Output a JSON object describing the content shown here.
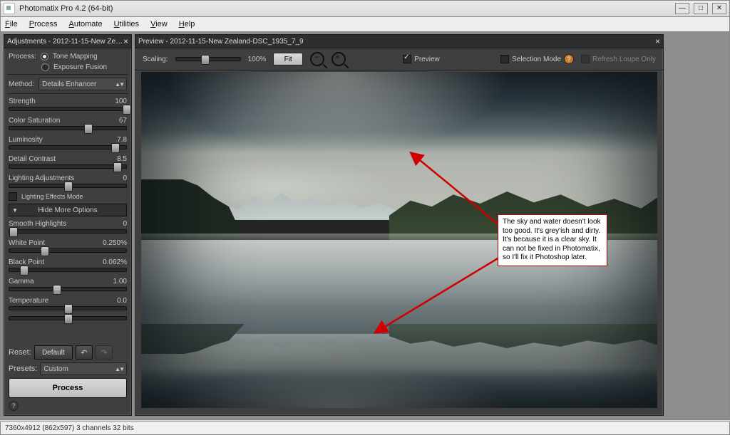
{
  "window": {
    "title": "Photomatix Pro 4.2 (64-bit)"
  },
  "menu": [
    "File",
    "Process",
    "Automate",
    "Utilities",
    "View",
    "Help"
  ],
  "adjust": {
    "title": "Adjustments - 2012-11-15-New Ze…",
    "process_label": "Process:",
    "modes": {
      "tone": "Tone Mapping",
      "fusion": "Exposure Fusion",
      "selected": "tone"
    },
    "method_label": "Method:",
    "method_value": "Details Enhancer",
    "sliders": [
      {
        "label": "Strength",
        "value": "100",
        "pos": 100
      },
      {
        "label": "Color Saturation",
        "value": "67",
        "pos": 67
      },
      {
        "label": "Luminosity",
        "value": "7.8",
        "pos": 90
      },
      {
        "label": "Detail Contrast",
        "value": "8.5",
        "pos": 92
      },
      {
        "label": "Lighting Adjustments",
        "value": "0",
        "pos": 50
      }
    ],
    "lighting_effects_label": "Lighting Effects Mode",
    "hide_more": "Hide More Options",
    "more": [
      {
        "label": "Smooth Highlights",
        "value": "0",
        "pos": 3
      },
      {
        "label": "White Point",
        "value": "0.250%",
        "pos": 30
      },
      {
        "label": "Black Point",
        "value": "0.062%",
        "pos": 12
      },
      {
        "label": "Gamma",
        "value": "1.00",
        "pos": 40
      },
      {
        "label": "Temperature",
        "value": "0.0",
        "pos": 50
      }
    ],
    "reset_label": "Reset:",
    "default_btn": "Default",
    "presets_label": "Presets:",
    "presets_value": "Custom",
    "process_btn": "Process"
  },
  "preview": {
    "title": "Preview - 2012-11-15-New Zealand-DSC_1935_7_9",
    "scaling_label": "Scaling:",
    "scaling_pct": "100%",
    "fit": "Fit",
    "preview_chk": "Preview",
    "selection_mode": "Selection Mode",
    "refresh_loupe": "Refresh Loupe Only"
  },
  "annotation": "The sky and water doesn't look too good. It's grey'ish and dirty. It's because it is a clear sky. It can not be fixed in Photomatix, so I'll fix it Photoshop later.",
  "status": "7360x4912 (862x597) 3 channels 32 bits"
}
